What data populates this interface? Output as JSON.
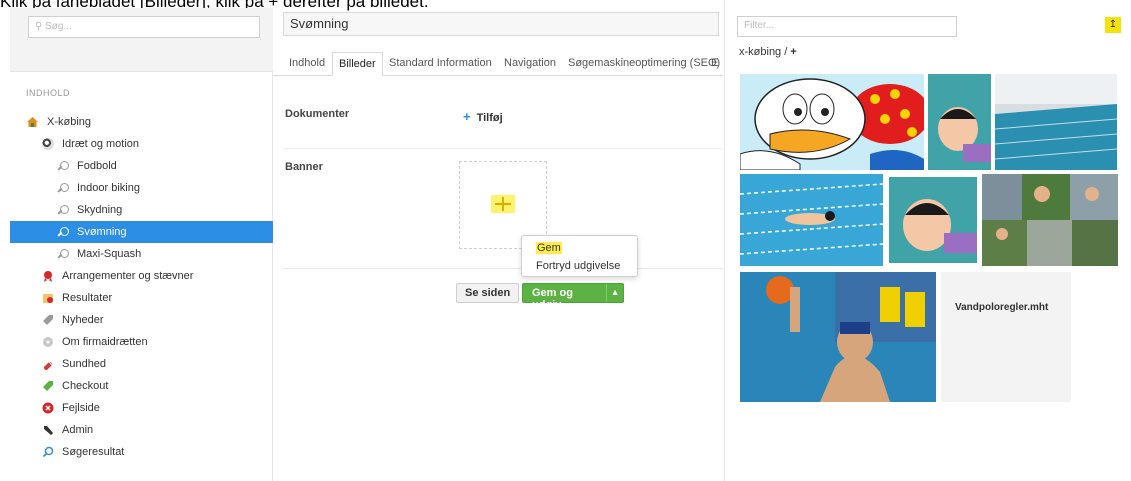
{
  "instruction_text": "Klik på fanebladet [Billeder], klik på + derefter på billedet.",
  "sidebar": {
    "search_placeholder": "Søg...",
    "section_label": "INDHOLD",
    "items": [
      {
        "label": "X-købing",
        "icon": "home-icon",
        "color": "#e38b1c",
        "level": 0
      },
      {
        "label": "Idræt og motion",
        "icon": "soccer-ball-icon",
        "color": "#444444",
        "level": 1
      },
      {
        "label": "Fodbold",
        "icon": "search-icon",
        "color": "#999999",
        "level": 2
      },
      {
        "label": "Indoor biking",
        "icon": "search-icon",
        "color": "#999999",
        "level": 2
      },
      {
        "label": "Skydning",
        "icon": "search-icon",
        "color": "#999999",
        "level": 2
      },
      {
        "label": "Svømning",
        "icon": "search-icon",
        "color": "#ffffff",
        "level": 2,
        "selected": true
      },
      {
        "label": "Maxi-Squash",
        "icon": "search-icon",
        "color": "#999999",
        "level": 2
      },
      {
        "label": "Arrangementer og stævner",
        "icon": "ribbon-icon",
        "color": "#d9262b",
        "level": 1
      },
      {
        "label": "Resultater",
        "icon": "certificate-icon",
        "color": "#e8a33c",
        "level": 1
      },
      {
        "label": "Nyheder",
        "icon": "tag-icon",
        "color": "#9a9a9a",
        "level": 1
      },
      {
        "label": "Om firmaidrætten",
        "icon": "disc-icon",
        "color": "#b9b9b9",
        "level": 1
      },
      {
        "label": "Sundhed",
        "icon": "pill-icon",
        "color": "#d33a3a",
        "level": 1
      },
      {
        "label": "Checkout",
        "icon": "tag-icon",
        "color": "#5cb343",
        "level": 1
      },
      {
        "label": "Fejlside",
        "icon": "error-icon",
        "color": "#d9262b",
        "level": 1
      },
      {
        "label": "Admin",
        "icon": "wrench-icon",
        "color": "#333333",
        "level": 1
      },
      {
        "label": "Søgeresultat",
        "icon": "search-icon",
        "color": "#2d8ee5",
        "level": 1
      }
    ]
  },
  "editor": {
    "title": "Svømning",
    "tabs": [
      "Indhold",
      "Billeder",
      "Standard Information",
      "Navigation",
      "Søgemaskineoptimering (SEO)",
      "E"
    ],
    "active_tab": "Billeder",
    "documents_label": "Dokumenter",
    "add_label": "Tilføj",
    "banner_label": "Banner",
    "see_button": "Se siden",
    "publish_button": "Gem og udgiv",
    "menu": {
      "save": "Gem",
      "undo_publish": "Fortryd udgivelse"
    }
  },
  "picker": {
    "filter_placeholder": "Filter...",
    "breadcrumb": "x-købing /",
    "breadcrumb_add": "+",
    "file_name": "Vandpoloregler.mht",
    "thumbnails": [
      "donald-duck-image",
      "baby-swimmer-image",
      "indoor-pool-image",
      "swimmer-lane-image",
      "baby-swimmer-image-2",
      "triathlon-collage-image",
      "water-polo-image"
    ]
  },
  "colors": {
    "accent": "#2d8ee5",
    "success": "#5cb343",
    "highlight": "#ffee4a"
  }
}
